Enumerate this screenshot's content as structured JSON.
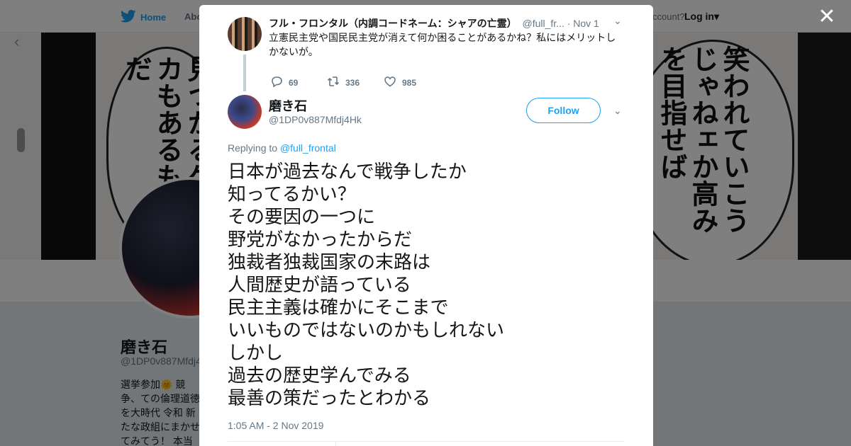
{
  "nav": {
    "home_label": "Home",
    "about_label": "Abo",
    "account_text": "ccount?",
    "login_label": "Log in"
  },
  "banner": {
    "left_text": "見つかるケンカもあるもんだ",
    "right_text": "笑われていこうじゃねェか高みを目指せば"
  },
  "profile": {
    "name": "磨き石",
    "handle": "@1DP0v887Mfdj4",
    "bio": "選挙参加🌞 競争、ての倫理道徳を大時代 令和 新たな政組にまかせてみてう！ 本当にぶれな"
  },
  "parent_tweet": {
    "name": "フル・フロンタル（内調コードネーム：シャアの亡霊）",
    "handle": "@full_fr...",
    "date": "· Nov 1",
    "text": "立憲民主党や国民民主党が消えて何か困ることがあるかね？私にはメリットしかないが。",
    "replies": "69",
    "retweets": "336",
    "likes": "985"
  },
  "tweet": {
    "author_name": "磨き石",
    "author_handle": "@1DP0v887Mfdj4Hk",
    "follow_label": "Follow",
    "replying_prefix": "Replying to",
    "replying_handle": "@full_frontal",
    "lines": [
      "日本が過去なんで戦争したか",
      "知ってるかい？",
      "その要因の一つに",
      "野党がなかったからだ",
      "独裁者独裁国家の末路は",
      "人間歴史が語っている",
      "民主主義は確かにそこまで",
      "いいものではないのかもしれない",
      "しかし",
      "過去の歴史学んでみる",
      "最善の策だったとわかる"
    ],
    "timestamp": "1:05 AM - 2 Nov 2019"
  },
  "colors": {
    "accent": "#1da1f2",
    "muted": "#657786",
    "text": "#14171a"
  }
}
